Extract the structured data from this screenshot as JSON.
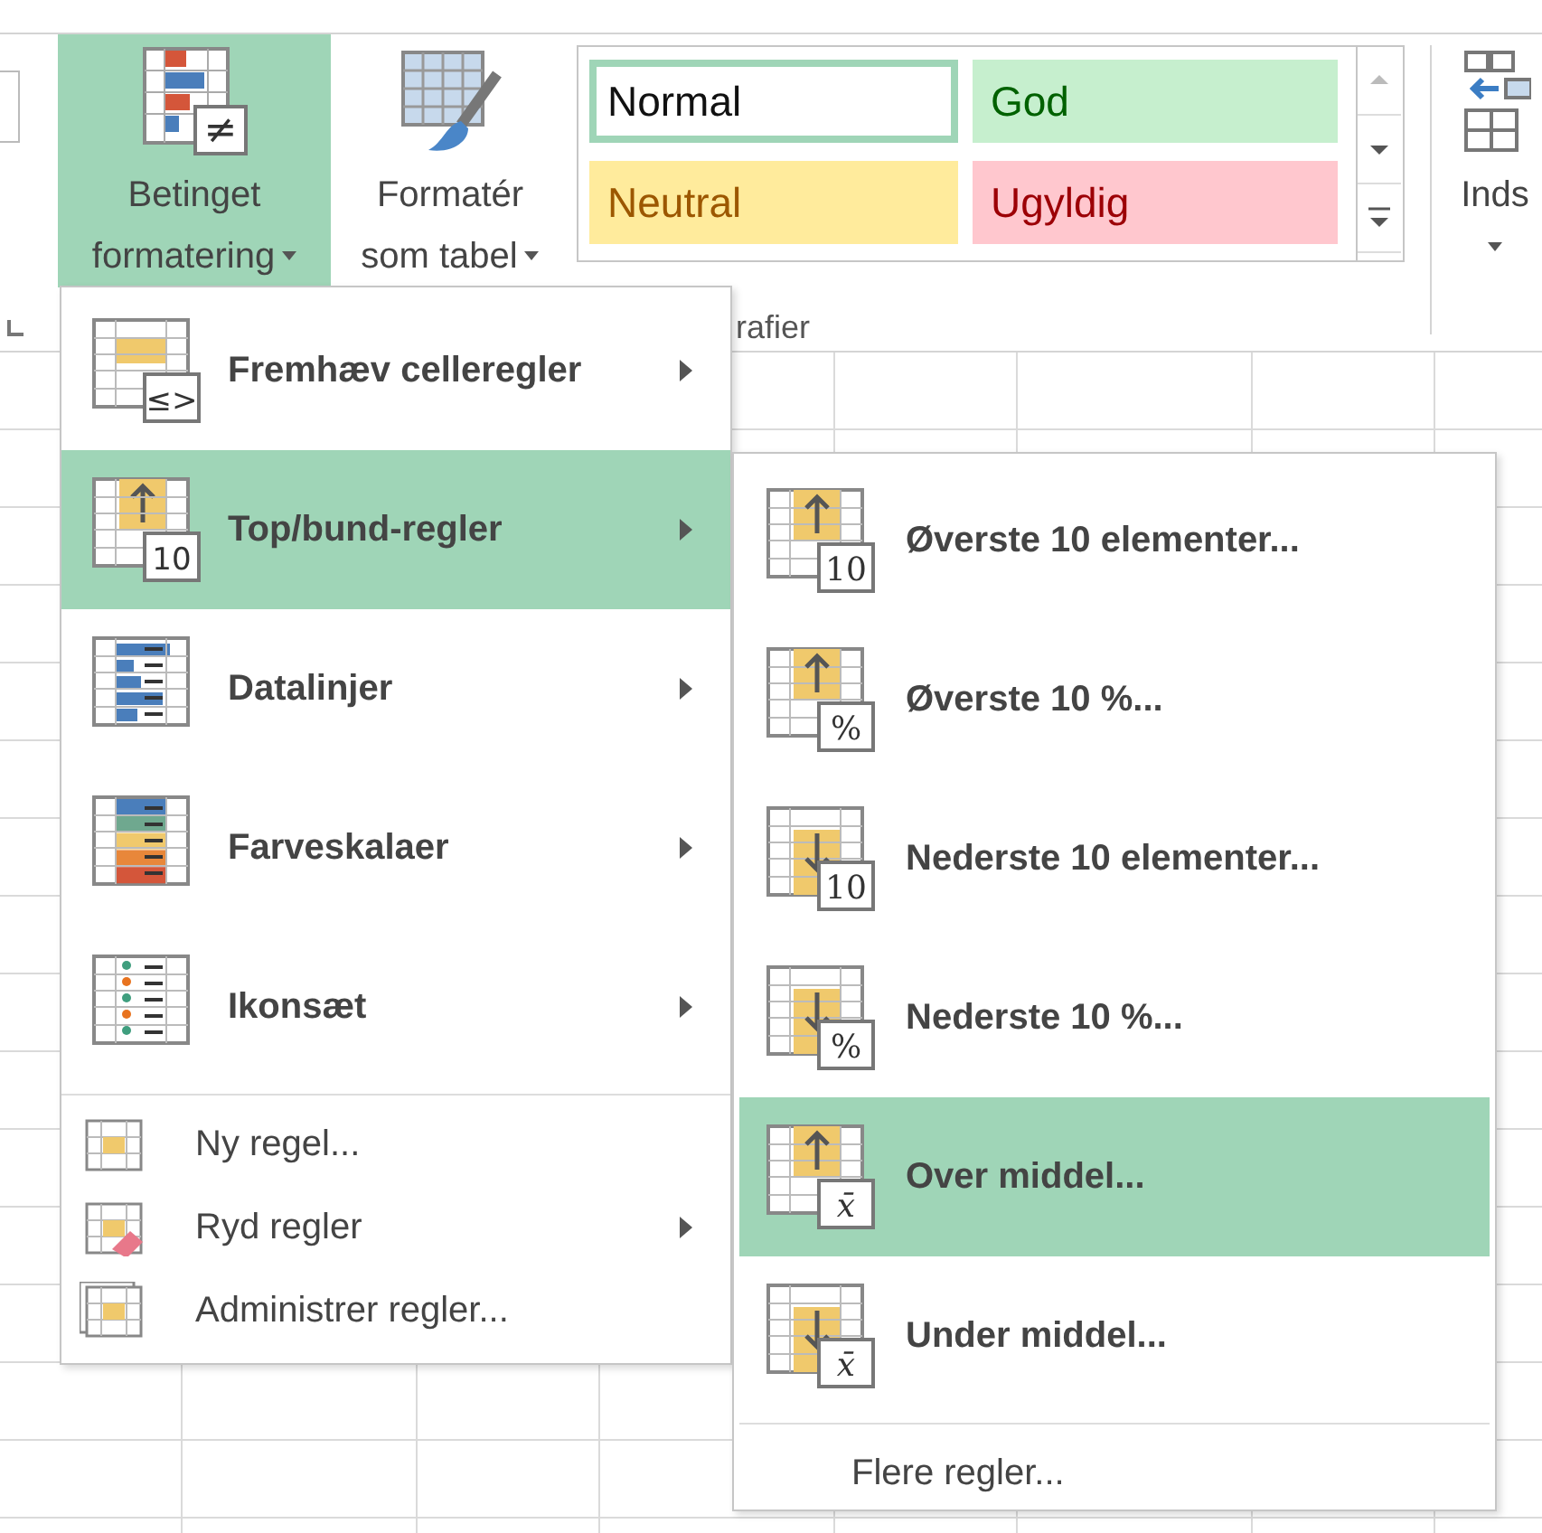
{
  "ribbon": {
    "buttons": [
      {
        "lines": [
          "Betinget",
          "formatering"
        ],
        "badge": "≠",
        "selected": true
      },
      {
        "lines": [
          "Formatér",
          "som tabel"
        ],
        "selected": false
      }
    ],
    "styles": [
      {
        "label": "Normal",
        "kind": "normal",
        "selected": true
      },
      {
        "label": "God",
        "kind": "good",
        "selected": false
      },
      {
        "label": "Neutral",
        "kind": "neutral",
        "selected": false
      },
      {
        "label": "Ugyldig",
        "kind": "bad",
        "selected": false
      }
    ],
    "group_label": "rafier",
    "insert_label": "Inds"
  },
  "menu": {
    "items": [
      {
        "label": "Fremhæv celleregler",
        "kind": "large",
        "badge": "≤>",
        "has_submenu": true,
        "selected": false
      },
      {
        "label": "Top/bund-regler",
        "kind": "large",
        "badge": "10",
        "has_submenu": true,
        "selected": true
      },
      {
        "label": "Datalinjer",
        "kind": "large",
        "has_submenu": true,
        "selected": false
      },
      {
        "label": "Farveskalaer",
        "kind": "large",
        "has_submenu": true,
        "selected": false
      },
      {
        "label": "Ikonsæt",
        "kind": "large",
        "has_submenu": true,
        "selected": false
      },
      {
        "label": "Ny regel...",
        "kind": "small",
        "has_submenu": false,
        "selected": false
      },
      {
        "label": "Ryd regler",
        "kind": "small",
        "has_submenu": true,
        "selected": false
      },
      {
        "label": "Administrer regler...",
        "kind": "small",
        "has_submenu": false,
        "selected": false
      }
    ]
  },
  "submenu": {
    "items": [
      {
        "label": "Øverste 10 elementer...",
        "kind": "up",
        "badge": "10",
        "selected": false
      },
      {
        "label": "Øverste 10 %...",
        "kind": "up",
        "badge": "%",
        "selected": false
      },
      {
        "label": "Nederste 10 elementer...",
        "kind": "down",
        "badge": "10",
        "selected": false
      },
      {
        "label": "Nederste 10 %...",
        "kind": "down",
        "badge": "%",
        "selected": false
      },
      {
        "label": "Over middel...",
        "kind": "up",
        "badge": "x̄",
        "selected": true
      },
      {
        "label": "Under middel...",
        "kind": "down",
        "badge": "x̄",
        "selected": false
      }
    ],
    "footer": "Flere regler..."
  }
}
